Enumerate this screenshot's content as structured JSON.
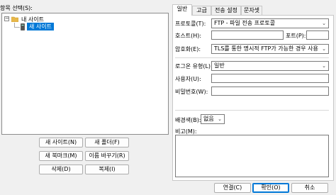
{
  "left": {
    "tree_label": "항목 선택(S):",
    "tree": {
      "root_label": "내 사이트",
      "root_toggle": "−",
      "child_label": "새 사이트"
    },
    "buttons": {
      "new_site": "새 사이트(N)",
      "new_folder": "새 폴더(F)",
      "new_bookmark": "새 북마크(M)",
      "rename": "이름 바꾸기(R)",
      "delete": "삭제(D)",
      "copy": "복제(I)"
    }
  },
  "tabs": [
    "일반",
    "고급",
    "전송 설정",
    "문자셋"
  ],
  "general": {
    "protocol_label": "프로토콜(T):",
    "protocol_value": "FTP - 파일 전송 프로토콜",
    "host_label": "호스트(H):",
    "host_value": "",
    "port_label": "포트(P):",
    "port_value": "",
    "encryption_label": "암호화(E):",
    "encryption_value": "TLS를 통한 명시적 FTP가 가능한 경우 사용",
    "logon_label": "로그온 유형(L):",
    "logon_value": "일반",
    "user_label": "사용자(U):",
    "user_value": "",
    "password_label": "비밀번호(W):",
    "password_value": "",
    "bgcolor_label": "배경색(B):",
    "bgcolor_value": "없음",
    "comments_label": "비고(M):",
    "comments_value": ""
  },
  "footer": {
    "connect": "연결(C)",
    "ok": "확인(O)",
    "cancel": "취소"
  },
  "icons": {
    "folder_color": "#e8b84a",
    "accent": "#0078d7"
  }
}
